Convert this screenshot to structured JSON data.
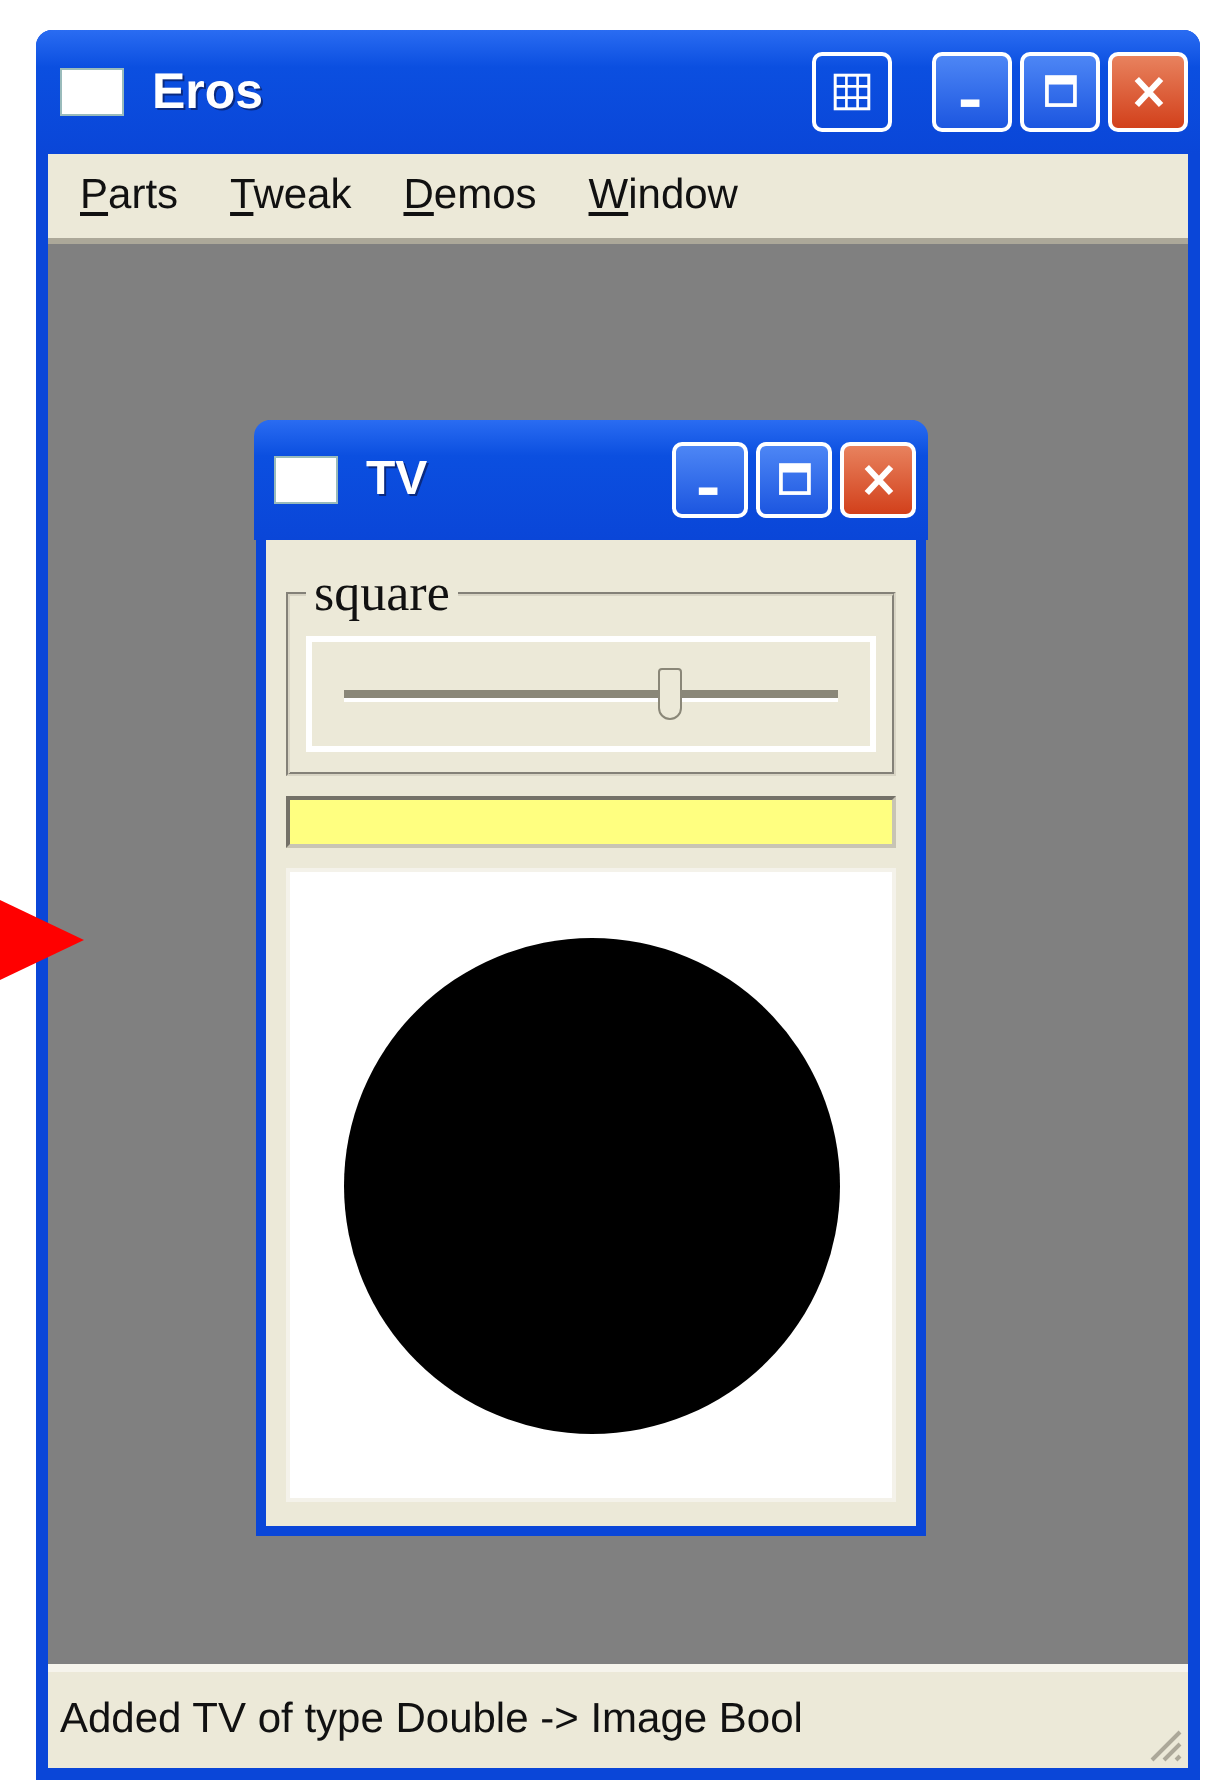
{
  "window": {
    "title": "Eros"
  },
  "menu": [
    {
      "label": "Parts"
    },
    {
      "label": "Tweak"
    },
    {
      "label": "Demos"
    },
    {
      "label": "Window"
    }
  ],
  "tv_window": {
    "title": "TV",
    "group_label": "square",
    "slider": {
      "level": 0.66
    }
  },
  "status_bar": "Added TV of type Double -> Image Bool"
}
